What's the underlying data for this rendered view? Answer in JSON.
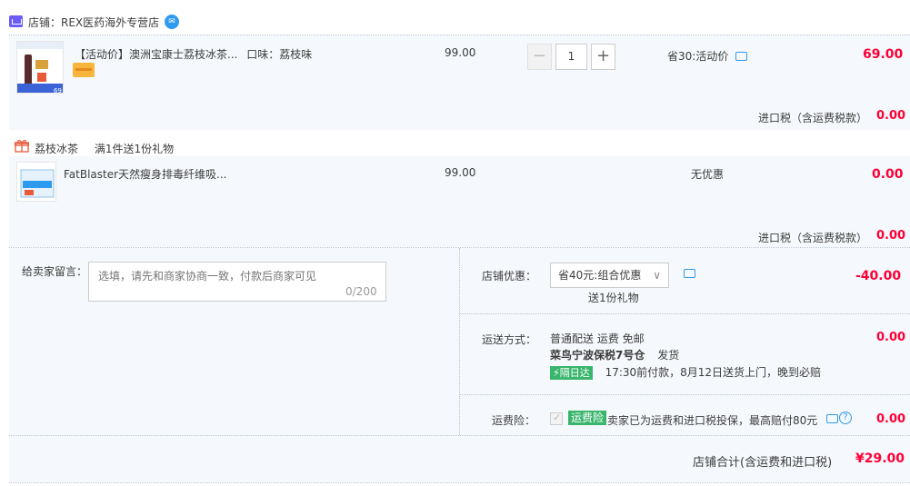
{
  "shop": {
    "label": "店铺：REX医药海外专营店",
    "icon": "shop-icon",
    "chat_icon": "wangwang-icon"
  },
  "items": [
    {
      "title": "【活动价】澳洲宝康士荔枝冰茶...",
      "flavor": "口味：荔枝味",
      "price": "99.00",
      "quantity": "1",
      "discount": "省30:活动价",
      "total": "69.00",
      "tax_label": "进口税（含运费税款）",
      "tax_value": "0.00",
      "thumb_price_tag": "69"
    },
    {
      "promo_title": "荔枝冰茶",
      "promo_text": "满1件送1份礼物",
      "title": "FatBlaster天然瘦身排毒纤维吸...",
      "price": "99.00",
      "discount": "无优惠",
      "total": "0.00",
      "tax_label": "进口税（含运费税款）",
      "tax_value": "0.00"
    }
  ],
  "message": {
    "label": "给卖家留言：",
    "placeholder": "选填，请先和商家协商一致，付款后商家可见",
    "counter": "0/200"
  },
  "shop_discount": {
    "label": "店铺优惠：",
    "selected": "省40元:组合优惠",
    "note": "送1份礼物",
    "amount": "-40.00"
  },
  "shipping": {
    "label": "运送方式：",
    "method": "普通配送 运费 免邮",
    "warehouse": "菜鸟宁波保税7号仓",
    "warehouse_suffix": "发货",
    "badge": "隔日达",
    "eta": "17:30前付款，8月12日送货上门，晚到必赔",
    "amount": "0.00"
  },
  "insurance": {
    "label": "运费险：",
    "badge": "运费险",
    "text": "卖家已为运费和进口税投保，最高赔付80元",
    "amount": "0.00"
  },
  "summary": {
    "label": "店铺合计(含运费和进口税)",
    "total": "¥29.00"
  },
  "colors": {
    "accent_red": "#ff0036",
    "panel_bg": "#f5f8fc",
    "link_blue": "#2f9bf0",
    "badge_green": "#3ab56c"
  }
}
